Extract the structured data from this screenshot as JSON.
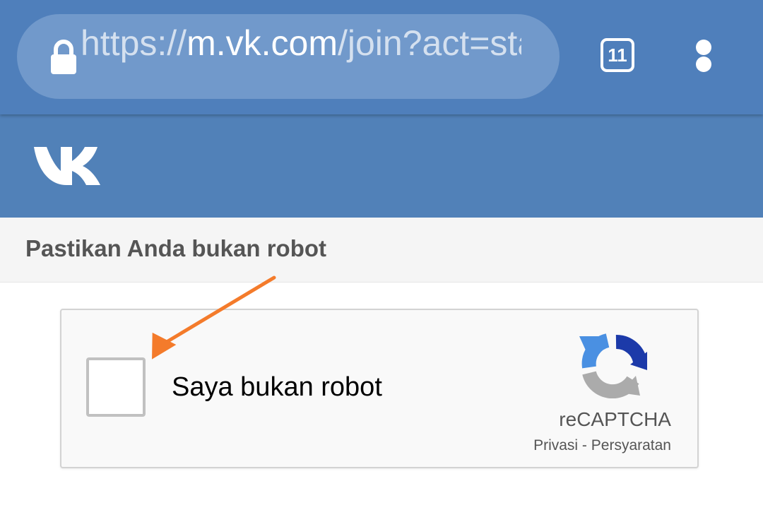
{
  "browser": {
    "url_scheme": "https://",
    "url_domain": "m.vk.com",
    "url_path": "/join?act=sta",
    "tab_count": "11",
    "lock_icon": "lock-icon",
    "menu_icon": "more-vert-icon"
  },
  "site": {
    "logo": "VK",
    "header_color": "#5181b8"
  },
  "page": {
    "title": "Pastikan Anda bukan robot"
  },
  "recaptcha": {
    "checkbox_label": "Saya bukan robot",
    "checked": false,
    "brand": "reCAPTCHA",
    "privacy_link": "Privasi",
    "separator": " - ",
    "terms_link": "Persyaratan"
  },
  "annotation": {
    "arrow_color": "#f47b2b"
  }
}
